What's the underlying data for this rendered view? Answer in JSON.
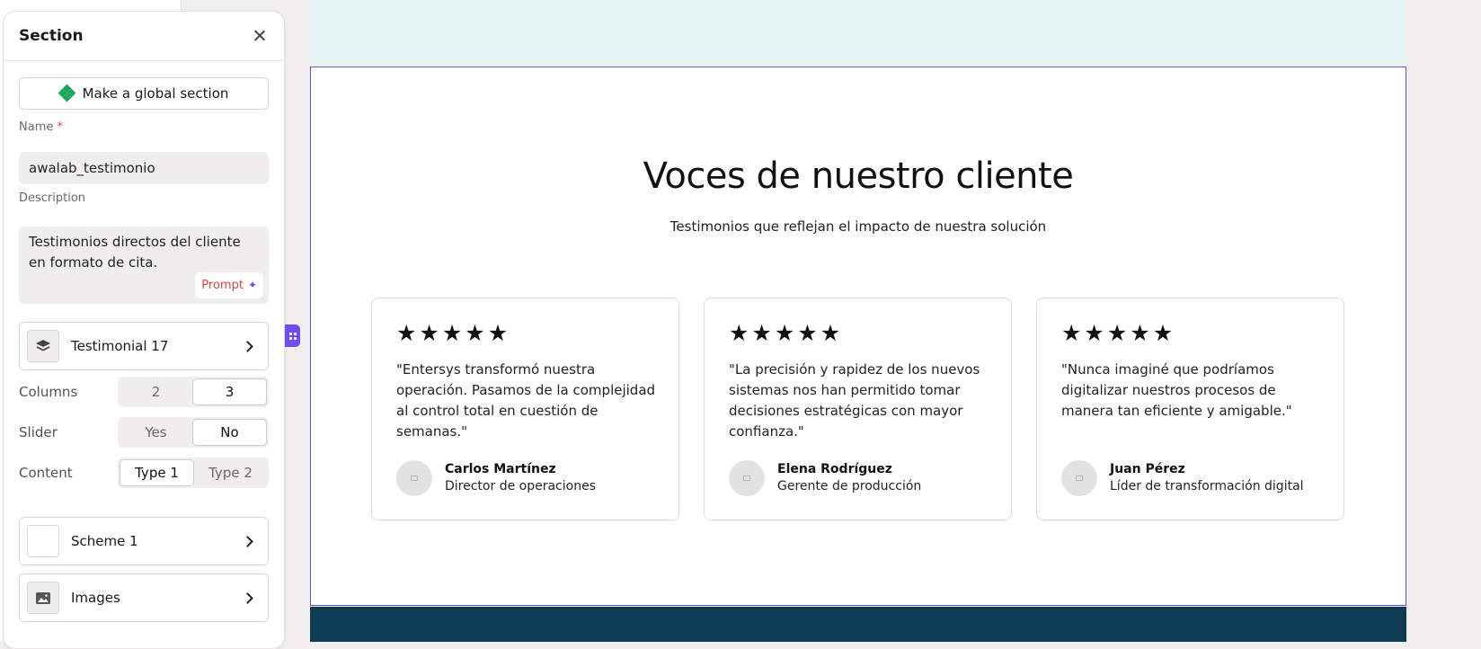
{
  "panel": {
    "title": "Section",
    "global_button": "Make a global section",
    "name_label": "Name",
    "required_mark": "*",
    "name_value": "awalab_testimonio",
    "description_label": "Description",
    "description_value": "Testimonios directos del cliente en formato de cita.",
    "prompt_label": "Prompt",
    "layout_card": "Testimonial 17",
    "columns": {
      "label": "Columns",
      "options": [
        "2",
        "3"
      ],
      "selected": "3"
    },
    "slider": {
      "label": "Slider",
      "options": [
        "Yes",
        "No"
      ],
      "selected": "No"
    },
    "content": {
      "label": "Content",
      "options": [
        "Type 1",
        "Type 2"
      ],
      "selected": "Type 1"
    },
    "scheme_card": "Scheme 1",
    "images_card": "Images"
  },
  "preview": {
    "title": "Voces de nuestro cliente",
    "subtitle": "Testimonios que reflejan el impacto de nuestra solución",
    "testimonials": [
      {
        "stars": 5,
        "quote": "\"Entersys transformó nuestra operación. Pasamos de la complejidad al control total en cuestión de semanas.\"",
        "name": "Carlos Martínez",
        "role": "Director de operaciones"
      },
      {
        "stars": 5,
        "quote": "\"La precisión y rapidez de los nuevos sistemas nos han permitido tomar decisiones estratégicas con mayor confianza.\"",
        "name": "Elena Rodríguez",
        "role": "Gerente de producción"
      },
      {
        "stars": 5,
        "quote": "\"Nunca imaginé que podríamos digitalizar nuestros procesos de manera tan eficiente y amigable.\"",
        "name": "Juan Pérez",
        "role": "Líder de transformación digital"
      }
    ]
  },
  "colors": {
    "accent": "#6b4ef5",
    "global_icon": "#1ba85a",
    "top_strip": "#e4f4f4",
    "bottom_strip": "#0d3b52",
    "prompt": "#e0453a"
  },
  "icons": [
    "close-icon",
    "diamond-icon",
    "sparkle-icon",
    "layers-icon",
    "image-icon",
    "chevron-right-icon",
    "star-icon",
    "drag-handle-icon"
  ]
}
